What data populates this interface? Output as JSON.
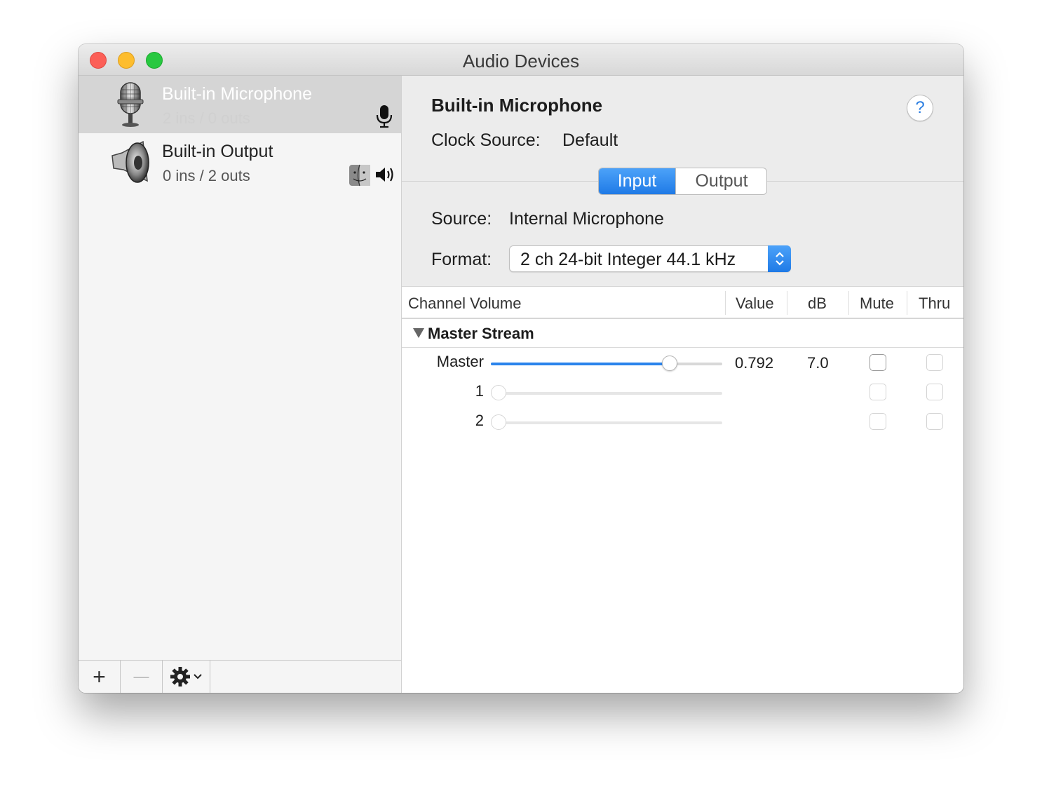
{
  "window": {
    "title": "Audio Devices"
  },
  "sidebar": {
    "devices": [
      {
        "name": "Built-in Microphone",
        "io": "2 ins / 0 outs",
        "selected": true,
        "icon": "microphone-icon",
        "status_icons": [
          "microphone-icon"
        ]
      },
      {
        "name": "Built-in Output",
        "io": "0 ins / 2 outs",
        "selected": false,
        "icon": "speaker-icon",
        "status_icons": [
          "finder-icon",
          "speaker-volume-icon"
        ]
      }
    ],
    "footer": {
      "add_label": "+",
      "remove_label": "—"
    }
  },
  "detail": {
    "device_name": "Built-in Microphone",
    "clock_source_label": "Clock Source:",
    "clock_source_value": "Default",
    "help_label": "?",
    "tabs": [
      {
        "label": "Input",
        "active": true
      },
      {
        "label": "Output",
        "active": false
      }
    ],
    "source_label": "Source:",
    "source_value": "Internal Microphone",
    "format_label": "Format:",
    "format_value": "2 ch 24-bit Integer 44.1 kHz"
  },
  "table": {
    "headers": {
      "channel_volume": "Channel Volume",
      "value": "Value",
      "db": "dB",
      "mute": "Mute",
      "thru": "Thru"
    },
    "group": {
      "label": "Master Stream"
    },
    "rows": [
      {
        "label": "Master",
        "volume": 0.792,
        "value": "0.792",
        "db": "7.0",
        "enabled": true
      },
      {
        "label": "1",
        "volume": 0,
        "value": "",
        "db": "",
        "enabled": false
      },
      {
        "label": "2",
        "volume": 0,
        "value": "",
        "db": "",
        "enabled": false
      }
    ]
  },
  "colors": {
    "accent": "#2a84ec",
    "selection": "#d5d5d5",
    "close": "#fc5f57",
    "minimize": "#fdbd2e",
    "zoom": "#28c840"
  }
}
